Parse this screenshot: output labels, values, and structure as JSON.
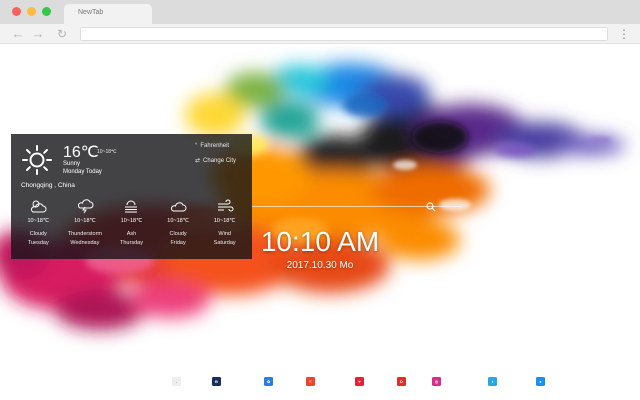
{
  "browser": {
    "tab_title": "NewTab",
    "back_glyph": "←",
    "forward_glyph": "→",
    "reload_glyph": "↻",
    "menu_glyph": "⋮"
  },
  "weather": {
    "temperature": "16℃",
    "range": "10~18℃",
    "condition": "Sunny",
    "day": "Monday Today",
    "location": "Chongqing , China",
    "fahrenheit_label": "Fahrenheit",
    "change_city_label": "Change City",
    "forecast": [
      {
        "icon": "partly-cloudy-icon",
        "range": "10~18℃",
        "condition": "Cloudy",
        "day": "Tuesday"
      },
      {
        "icon": "thunderstorm-icon",
        "range": "10~18℃",
        "condition": "Thunderstorm",
        "day": "Wednesday"
      },
      {
        "icon": "ash-icon",
        "range": "10~18℃",
        "condition": "Ash",
        "day": "Thursday"
      },
      {
        "icon": "cloud-icon",
        "range": "10~18℃",
        "condition": "Cloudy",
        "day": "Friday"
      },
      {
        "icon": "wind-icon",
        "range": "10~18℃",
        "condition": "Wind",
        "day": "Saturday"
      }
    ]
  },
  "clock": {
    "time": "10:10 AM",
    "date": "2017.10.30 Mo"
  },
  "shortcuts": [
    {
      "name": "shortcut-1",
      "color": "#eeeeee",
      "label": "."
    },
    {
      "name": "shortcut-2",
      "color": "#1a2b5e",
      "label": "B"
    },
    {
      "name": "shortcut-3",
      "color": "#2b7bf0",
      "label": "✿"
    },
    {
      "name": "shortcut-4",
      "color": "#f0432c",
      "label": "≡"
    },
    {
      "name": "shortcut-5",
      "color": "#e52233",
      "label": "♥"
    },
    {
      "name": "shortcut-6",
      "color": "#e62a2a",
      "label": "D"
    },
    {
      "name": "shortcut-7",
      "color": "#d62e8a",
      "label": "◎"
    },
    {
      "name": "shortcut-8",
      "color": "#27a7e5",
      "label": "t"
    },
    {
      "name": "shortcut-9",
      "color": "#1d8ff0",
      "label": "●"
    }
  ],
  "colors": {
    "smoke": [
      "#e91e63",
      "#f44336",
      "#ff9800",
      "#ffeb3b",
      "#8bc34a",
      "#26c6da",
      "#2196f3",
      "#673ab7",
      "#212121"
    ]
  }
}
